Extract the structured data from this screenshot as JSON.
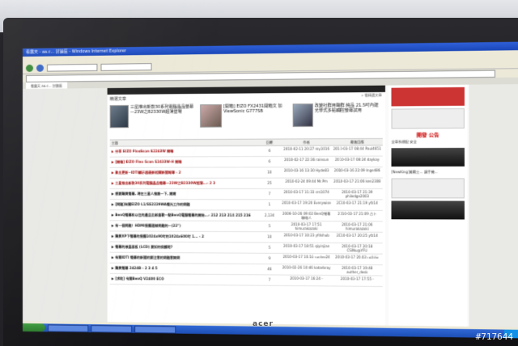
{
  "photo": {
    "watermark": "#717644",
    "monitor_brand": "acer"
  },
  "browser": {
    "title": "看露天 - aa.c... 討論區 - Windows Internet Explorer",
    "tab": "看露天 aa.c… 討論區"
  },
  "featured": {
    "heading": "精選文章",
    "more": "» 看精選文章",
    "articles": [
      {
        "text": "三星推出新款30系列電腦晶品螢幕—23W之B2330W超薄登場"
      },
      {
        "text": "[開箱] EIZO FX2431開箱文 加 ViewSonic G777SB"
      },
      {
        "text": "改變社群用聲群 純品 21.5吋內建光學式多點觸控螢幕試用"
      }
    ]
  },
  "forum_table": {
    "headers": [
      "主題",
      "回覆",
      "作者",
      "最後回應"
    ],
    "rows": [
      {
        "title": "▶ 分享 EIZO FlexScan S2243W 開箱",
        "replies": "6",
        "author": "2010-02-11 20:27 roy1016",
        "last": "2010-03-17 08:44 Paul4651",
        "red": true
      },
      {
        "title": "▶ [開箱] EIZO Flex Scan S2433W-H 開箱",
        "replies": "6",
        "author": "2010-02-17 22:36 rainsun",
        "last": "2010-03-17 08:24 daykay",
        "red": true
      },
      {
        "title": "▶ 聚出更新~IDTI顯示器最新相關新聞報導 ‹ 2",
        "replies": "10",
        "author": "2010-03-16 13:30 Hyde83",
        "last": "2010-03-16 22:09 Inge486",
        "red": true
      },
      {
        "title": "▶ 三星推出新款30系列電腦晶品螢幕—23W之B2330W超薄...‹ 2 3",
        "replies": "25",
        "author": "2010-02-24 09:44 Mr.Pm",
        "last": "2010-03-17 21:06 ken2308",
        "red": true
      },
      {
        "title": "▶ 想要購買螢幕, 現在三星人推誰一下, 謝謝",
        "replies": "7",
        "author": "2010-03-17 11:33 crs1074",
        "last": "2010-03-17 21:39 philedge2003",
        "red": false
      },
      {
        "title": "▶ [問題]有關EIZO L1/SS2229WA螢光工作的問題",
        "replies": "1",
        "author": "2010-03-17 19:20 Everywise",
        "last": "2010-03-17 21:19 yfz14",
        "red": false
      },
      {
        "title": "▶ BenQ螢幕和以往的產品比較喜歡一點BenQ電腦螢幕的開始...‹ 212 213 214 215 216",
        "replies": "2,134",
        "author": "2006-10-26 09:02 BenQ螢幕聯絡人",
        "last": "2010-03-17 21:09 占卜",
        "red": false
      },
      {
        "title": "▶ 有一個問題！HDMI接觸連線問題的一(22\")",
        "replies": "5",
        "author": "2010-03-17 17:51 himurakazoki",
        "last": "2010-03-17 21:06 himurakazoki",
        "red": false
      },
      {
        "title": "▶ 購買XP下螢幕的接觸1024x90吋的1024x600吋 1... ‹ 2",
        "replies": "10",
        "author": "2010-03-17 10:23 yfdshub",
        "last": "2010-03-17 20:25 yfz14",
        "red": false
      },
      {
        "title": "▶ 螢幕的液晶面板 (LCD) 要如何保護呢?",
        "replies": "5",
        "author": "2010-03-17 18:51 qiyinjian",
        "last": "2010-03-17 20:18 CSINu@YFU",
        "red": false
      },
      {
        "title": "▶ 有關IDTI 螢幕的新聞的要注意的問題意詢問",
        "replies": "9",
        "author": "2010-03-17 10:16 runlee24",
        "last": "2010-03-17 20:03 ruthhir",
        "red": false
      },
      {
        "title": "▶ 購買螢幕 2424B ‹ 2 3 4 5",
        "replies": "46",
        "author": "2010-02-26 10:46 katarbray",
        "last": "2010-03-17 19:48 auther_desk",
        "red": false
      },
      {
        "title": "▶ [求助] 有關BenQ V2400 ECO",
        "replies": "7",
        "author": "2010-03-17 16:24 -",
        "last": "2010-03-17 17:55 -",
        "red": false
      }
    ]
  },
  "sidebar": {
    "promo_1": "開發 公告",
    "promo_2": "全車系標配 安全",
    "promo_3": "[NewKing]美戰士... 讓手機..."
  }
}
